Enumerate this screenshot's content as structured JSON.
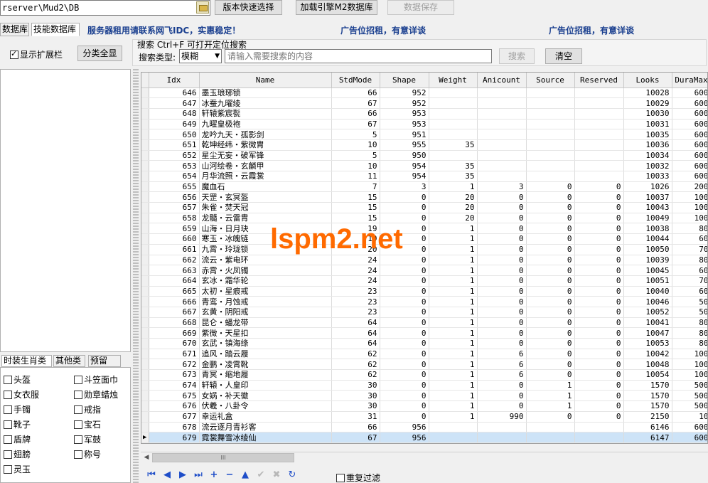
{
  "toolbar": {
    "db_path": "rserver\\Mud2\\DB",
    "version_button": "版本快速选择",
    "engine_button": "加载引擎M2数据库",
    "save_button": "数据保存"
  },
  "tabs": {
    "database": "数据库",
    "skill_database": "技能数据库"
  },
  "ads": {
    "ad1": "服务器租用请联系网飞IDC，实惠稳定！",
    "ad2": "广告位招租，有意详谈",
    "ad3": "广告位招租，有意详谈"
  },
  "options": {
    "show_ext_label": "显示扩展栏",
    "show_ext_checked": true,
    "category_button": "分类全显"
  },
  "search": {
    "legend": "搜索   Ctrl+F 可打开定位搜索",
    "type_label": "搜索类型:",
    "type_value": "模糊",
    "placeholder": "请输入需要搜索的内容",
    "search_button": "搜索",
    "clear_button": "清空"
  },
  "bottom_tabs": [
    "时装生肖类",
    "其他类",
    "预留"
  ],
  "categories": [
    {
      "label": "头盔",
      "checked": false
    },
    {
      "label": "斗笠面巾",
      "checked": false
    },
    {
      "label": "女衣服",
      "checked": false
    },
    {
      "label": "勋章蜡烛",
      "checked": false
    },
    {
      "label": "手镯",
      "checked": false
    },
    {
      "label": "戒指",
      "checked": false
    },
    {
      "label": "靴子",
      "checked": false
    },
    {
      "label": "宝石",
      "checked": false
    },
    {
      "label": "盾牌",
      "checked": false
    },
    {
      "label": "军鼓",
      "checked": false
    },
    {
      "label": "翅膀",
      "checked": false
    },
    {
      "label": "称号",
      "checked": false
    },
    {
      "label": "灵玉",
      "checked": false
    }
  ],
  "grid": {
    "columns": [
      "Idx",
      "Name",
      "StdMode",
      "Shape",
      "Weight",
      "Anicount",
      "Source",
      "Reserved",
      "Looks",
      "DuraMax"
    ],
    "rows": [
      [
        "646",
        "墨玉琅琊锁",
        "66",
        "952",
        "",
        "",
        "",
        "",
        "10028",
        "600"
      ],
      [
        "647",
        "冰蚕九曜绫",
        "67",
        "952",
        "",
        "",
        "",
        "",
        "10029",
        "600"
      ],
      [
        "648",
        "轩辕紫宸甏",
        "66",
        "953",
        "",
        "",
        "",
        "",
        "10030",
        "600"
      ],
      [
        "649",
        "九曜皇极袍",
        "67",
        "953",
        "",
        "",
        "",
        "",
        "10031",
        "600"
      ],
      [
        "650",
        "龙吟九天・孤影剑",
        "5",
        "951",
        "",
        "",
        "",
        "",
        "10035",
        "600"
      ],
      [
        "651",
        "乾坤经纬・紫微胄",
        "10",
        "955",
        "35",
        "",
        "",
        "",
        "10036",
        "600"
      ],
      [
        "652",
        "星尘无妄・破军锋",
        "5",
        "950",
        "",
        "",
        "",
        "",
        "10034",
        "600"
      ],
      [
        "653",
        "山河绘卷・玄麟甲",
        "10",
        "954",
        "35",
        "",
        "",
        "",
        "10032",
        "600"
      ],
      [
        "654",
        "月华流照・云霞裳",
        "11",
        "954",
        "35",
        "",
        "",
        "",
        "10033",
        "600"
      ],
      [
        "655",
        "魔血石",
        "7",
        "3",
        "1",
        "3",
        "0",
        "0",
        "1026",
        "200"
      ],
      [
        "656",
        "天罡・玄冥盔",
        "15",
        "0",
        "20",
        "0",
        "0",
        "0",
        "10037",
        "100"
      ],
      [
        "657",
        "朱雀・焚天冠",
        "15",
        "0",
        "20",
        "0",
        "0",
        "0",
        "10043",
        "100"
      ],
      [
        "658",
        "龙髓・云雷胄",
        "15",
        "0",
        "20",
        "0",
        "0",
        "0",
        "10049",
        "100"
      ],
      [
        "659",
        "山海・日月玦",
        "19",
        "0",
        "1",
        "0",
        "0",
        "0",
        "10038",
        "80"
      ],
      [
        "660",
        "寒玉・冰魄链",
        "19",
        "0",
        "1",
        "0",
        "0",
        "0",
        "10044",
        "60"
      ],
      [
        "661",
        "九霄・玲珑锁",
        "20",
        "0",
        "1",
        "0",
        "0",
        "0",
        "10050",
        "70"
      ],
      [
        "662",
        "流云・紫电环",
        "24",
        "0",
        "1",
        "0",
        "0",
        "0",
        "10039",
        "80"
      ],
      [
        "663",
        "赤霄・火凤镯",
        "24",
        "0",
        "1",
        "0",
        "0",
        "0",
        "10045",
        "60"
      ],
      [
        "664",
        "玄冰・霜华轮",
        "24",
        "0",
        "1",
        "0",
        "0",
        "0",
        "10051",
        "70"
      ],
      [
        "665",
        "太初・星痕戒",
        "23",
        "0",
        "1",
        "0",
        "0",
        "0",
        "10040",
        "60"
      ],
      [
        "666",
        "青鸾・月蚀戒",
        "23",
        "0",
        "1",
        "0",
        "0",
        "0",
        "10046",
        "50"
      ],
      [
        "667",
        "玄黄・阴阳戒",
        "23",
        "0",
        "1",
        "0",
        "0",
        "0",
        "10052",
        "50"
      ],
      [
        "668",
        "昆仑・蟠龙带",
        "64",
        "0",
        "1",
        "0",
        "0",
        "0",
        "10041",
        "80"
      ],
      [
        "669",
        "紫微・天星扣",
        "64",
        "0",
        "1",
        "0",
        "0",
        "0",
        "10047",
        "80"
      ],
      [
        "670",
        "玄武・镇海绦",
        "64",
        "0",
        "1",
        "0",
        "0",
        "0",
        "10053",
        "80"
      ],
      [
        "671",
        "追风・踏云履",
        "62",
        "0",
        "1",
        "6",
        "0",
        "0",
        "10042",
        "100"
      ],
      [
        "672",
        "金鹏・凌霄靴",
        "62",
        "0",
        "1",
        "6",
        "0",
        "0",
        "10048",
        "100"
      ],
      [
        "673",
        "青冥・缩地履",
        "62",
        "0",
        "1",
        "6",
        "0",
        "0",
        "10054",
        "100"
      ],
      [
        "674",
        "轩辕・人皇印",
        "30",
        "0",
        "1",
        "0",
        "1",
        "0",
        "1570",
        "500"
      ],
      [
        "675",
        "女娲・补天徽",
        "30",
        "0",
        "1",
        "0",
        "1",
        "0",
        "1570",
        "500"
      ],
      [
        "676",
        "伏羲・八卦令",
        "30",
        "0",
        "1",
        "0",
        "1",
        "0",
        "1570",
        "500"
      ],
      [
        "677",
        "幸运礼盒",
        "31",
        "0",
        "1",
        "990",
        "0",
        "0",
        "2150",
        "10"
      ],
      [
        "678",
        "流云逐月青衫客",
        "66",
        "956",
        "",
        "",
        "",
        "",
        "6146",
        "600"
      ],
      [
        "679",
        "霓裳舞雪冰绫仙",
        "67",
        "956",
        "",
        "",
        "",
        "",
        "6147",
        "600"
      ]
    ],
    "selected_row_index": 33
  },
  "scrollbar": {
    "thumb_grip": "III"
  },
  "navigator": {
    "icons": [
      "first-icon",
      "prior-icon",
      "next-icon",
      "last-icon",
      "insert-icon",
      "delete-icon",
      "edit-icon",
      "post-icon",
      "cancel-icon",
      "refresh-icon"
    ]
  },
  "footer": {
    "repeat_filter_label": "重复过滤",
    "repeat_filter_checked": false
  },
  "watermark": "lspm2.net",
  "colors": {
    "ad_text": "#1a3f8f",
    "watermark": "#ff6a00",
    "selection": "#cde3f7",
    "navigator": "#1f4ec8"
  }
}
